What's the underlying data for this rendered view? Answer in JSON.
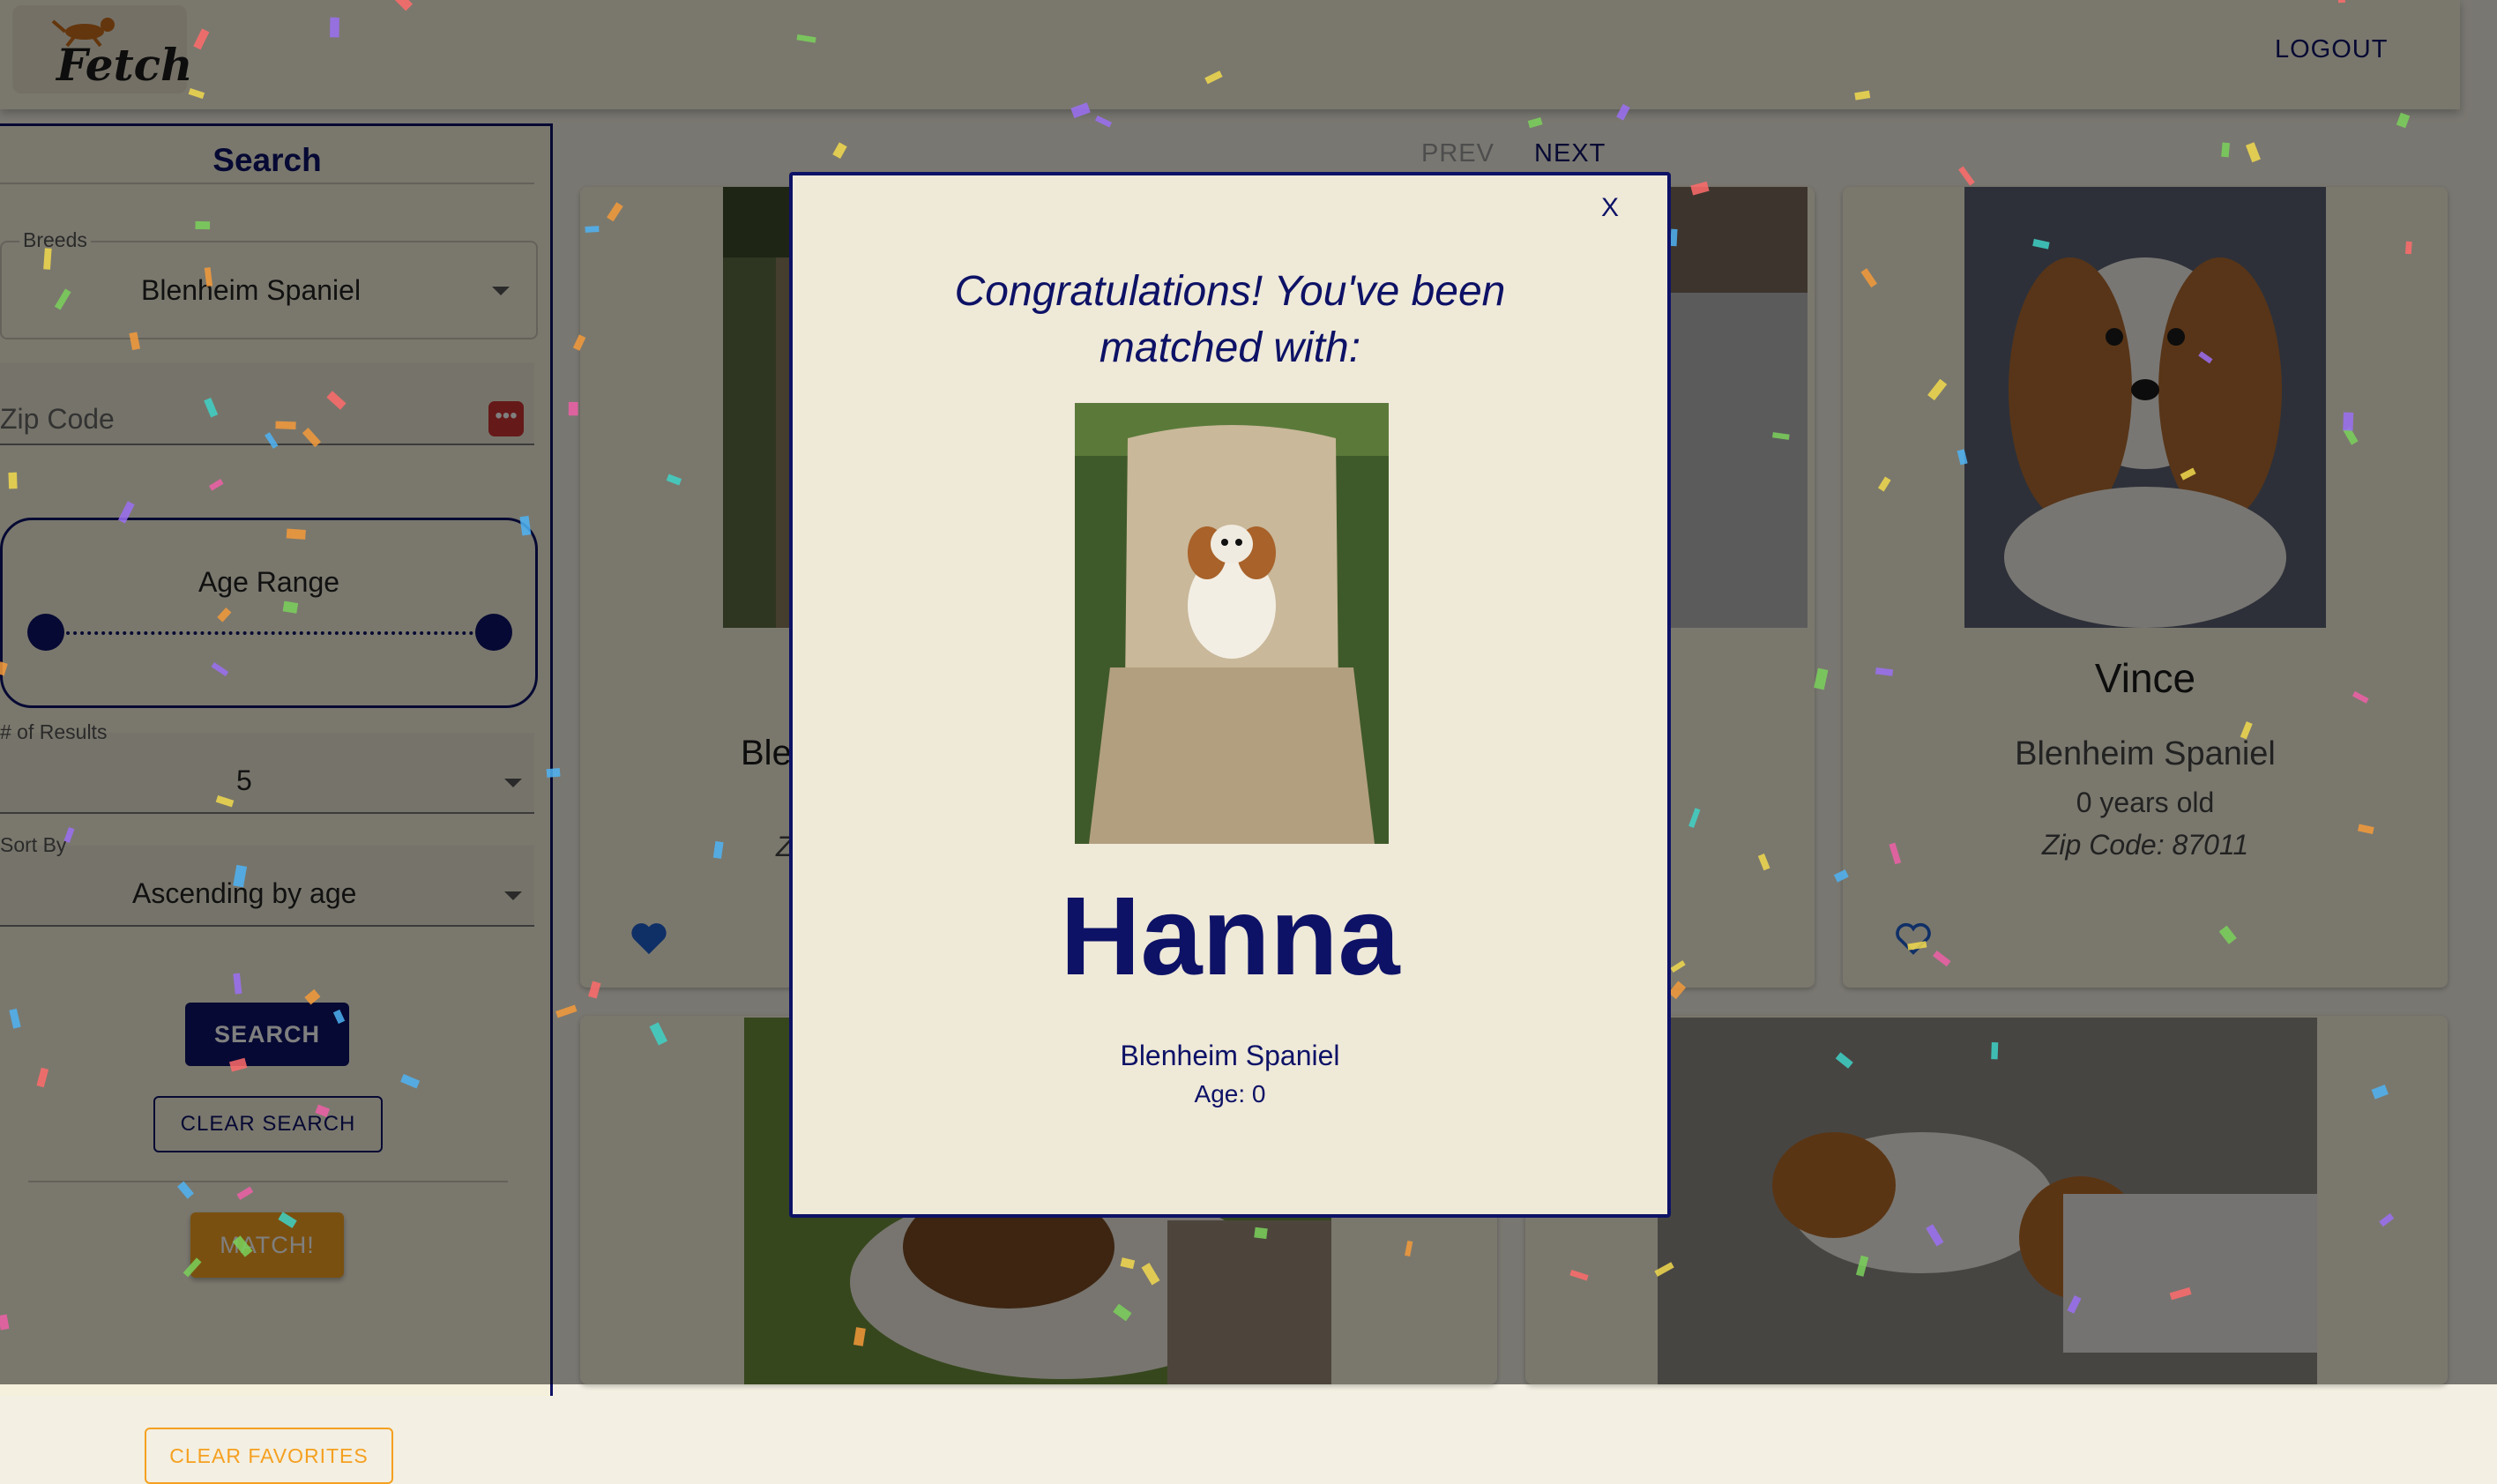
{
  "header": {
    "logo_text": "Fetch",
    "logout_label": "LOGOUT"
  },
  "sidebar": {
    "title": "Search",
    "breeds": {
      "label": "Breeds",
      "value": "Blenheim Spaniel"
    },
    "zip": {
      "placeholder": "Zip Code",
      "value": ""
    },
    "age_range": {
      "label": "Age Range",
      "min_fraction": 0.0,
      "max_fraction": 1.0
    },
    "results": {
      "label": "# of Results",
      "value": "5"
    },
    "sort": {
      "label": "Sort By",
      "value": "Ascending by age"
    },
    "search_label": "SEARCH",
    "clear_search_label": "CLEAR SEARCH",
    "match_label": "MATCH!",
    "clear_favorites_label": "CLEAR FAVORITES"
  },
  "pager": {
    "prev_label": "PREV",
    "next_label": "NEXT"
  },
  "cards": [
    {
      "name": "",
      "breed_partial": "Ble",
      "zip_partial": "Z",
      "favorited": true
    },
    {
      "name": "Vince",
      "breed": "Blenheim Spaniel",
      "age": "0 years old",
      "zip": "Zip Code: 87011",
      "favorited": false
    }
  ],
  "modal": {
    "close_label": "X",
    "title": "Congratulations! You've been matched with:",
    "name": "Hanna",
    "breed": "Blenheim Spaniel",
    "age": "Age: 0"
  },
  "colors": {
    "primary": "#0d1266",
    "accent": "#f5a020",
    "background": "#f5f0db",
    "modal_bg": "#efe9d8"
  }
}
